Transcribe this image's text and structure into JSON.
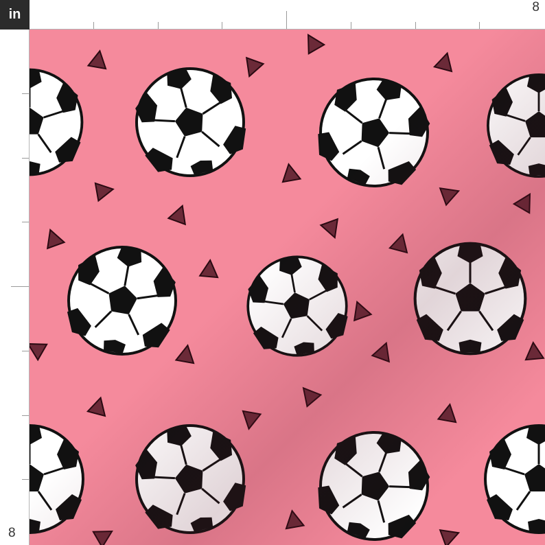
{
  "units": {
    "label": "in"
  },
  "ruler": {
    "top_end_label": "8",
    "left_end_label": "8"
  },
  "colors": {
    "background": "#f58a9c",
    "ball_white": "#ffffff",
    "ball_black": "#111111",
    "confetti": "#6b2a38"
  },
  "pattern": {
    "motif": "soccer-ball-icon",
    "accent": "triangle-confetti"
  }
}
